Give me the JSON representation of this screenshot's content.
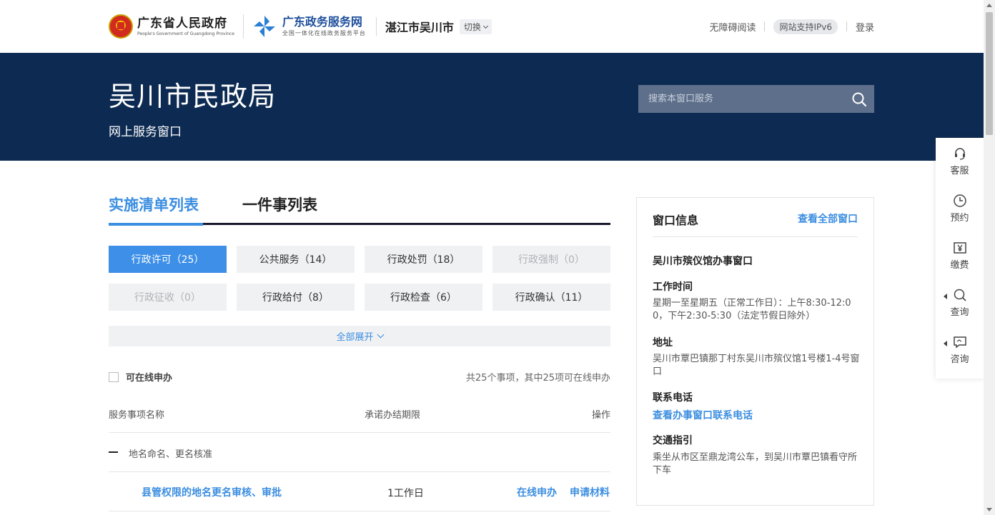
{
  "header": {
    "gov_name": "广东省人民政府",
    "gov_name_en": "People's Government of Guangdong Province",
    "service_name": "广东政务服务网",
    "service_sub": "全国一体化在线政务服务平台",
    "city": "湛江市吴川市",
    "switch_label": "切换",
    "accessible_read": "无障碍阅读",
    "ipv6": "网站支持IPv6",
    "login": "登录"
  },
  "banner": {
    "title": "吴川市民政局",
    "subtitle": "网上服务窗口",
    "search_placeholder": "搜索本窗口服务"
  },
  "tabs": [
    {
      "label": "实施清单列表",
      "active": true
    },
    {
      "label": "一件事列表",
      "active": false
    }
  ],
  "categories": [
    {
      "label": "行政许可（25）",
      "state": "active"
    },
    {
      "label": "公共服务（14）",
      "state": "normal"
    },
    {
      "label": "行政处罚（18）",
      "state": "normal"
    },
    {
      "label": "行政强制（0）",
      "state": "disabled"
    },
    {
      "label": "行政征收（0）",
      "state": "disabled"
    },
    {
      "label": "行政给付（8）",
      "state": "normal"
    },
    {
      "label": "行政检查（6）",
      "state": "normal"
    },
    {
      "label": "行政确认（11）",
      "state": "normal"
    }
  ],
  "expand_label": "全部展开",
  "filter": {
    "online_label": "可在线申办",
    "count_text": "共25个事项，其中25项可在线申办"
  },
  "table": {
    "headers": {
      "name": "服务事项名称",
      "deadline": "承诺办结期限",
      "action": "操作"
    },
    "group": "地名命名、更名核准",
    "items": [
      {
        "name": "县管权限的地名更名审核、审批",
        "deadline": "1工作日",
        "action_online": "在线申办",
        "action_material": "申请材料"
      }
    ]
  },
  "window_info": {
    "title": "窗口信息",
    "view_all": "查看全部窗口",
    "window_name": "吴川市殡仪馆办事窗口",
    "hours_label": "工作时间",
    "hours_line1": "星期一至星期五（正常工作日）：上午8:30-12:0",
    "hours_line2": "0，下午2:30-5:30（法定节假日除外）",
    "address_label": "地址",
    "address_line1": "吴川市覃巴镇那丁村东吴川市殡仪馆1号楼1-4号窗",
    "address_line2": "口",
    "phone_label": "联系电话",
    "phone_link": "查看办事窗口联系电话",
    "traffic_label": "交通指引",
    "traffic_line1": "乘坐从市区至鼎龙湾公车，到吴川市覃巴镇看守所",
    "traffic_line2": "下车"
  },
  "side_menu": [
    {
      "label": "客服",
      "icon": "headset-icon"
    },
    {
      "label": "预约",
      "icon": "clock-icon"
    },
    {
      "label": "缴费",
      "icon": "yuan-icon"
    },
    {
      "label": "查询",
      "icon": "search-icon"
    },
    {
      "label": "咨询",
      "icon": "chat-icon"
    }
  ],
  "colors": {
    "banner": "#0d2b52",
    "accent": "#3c8ee0",
    "search_bg": "#5d6f8a"
  }
}
